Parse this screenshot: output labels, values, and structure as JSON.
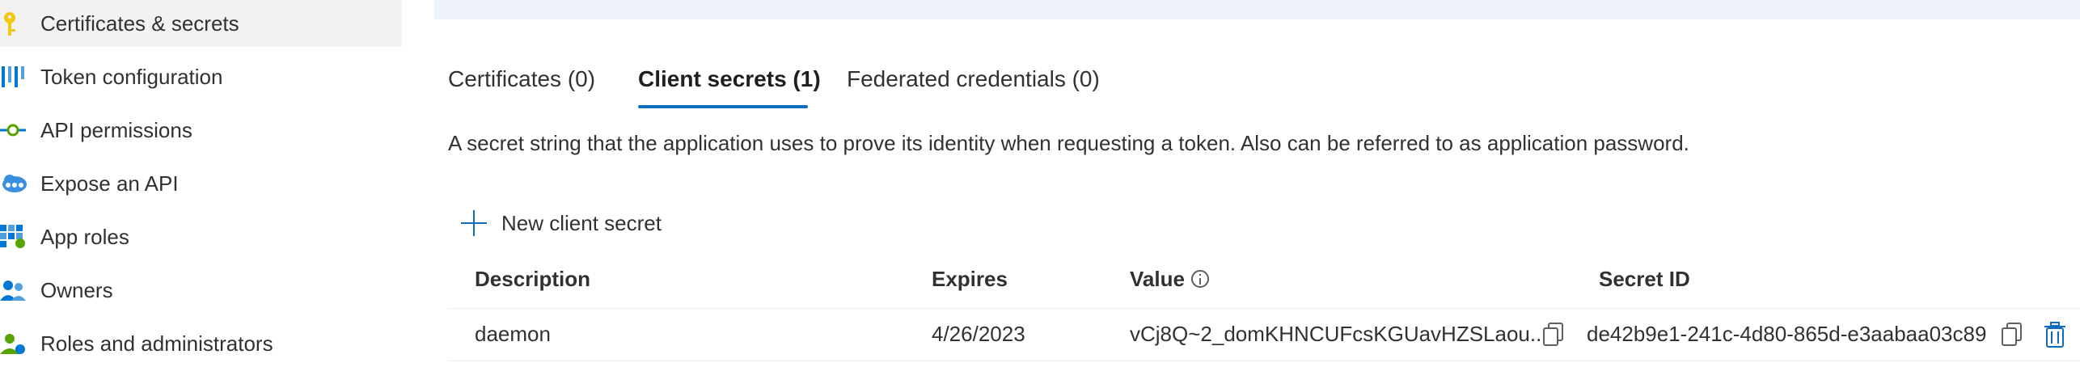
{
  "sidebar": {
    "items": [
      {
        "label": "Certificates & secrets",
        "icon": "key-icon",
        "selected": true
      },
      {
        "label": "Token configuration",
        "icon": "token-bars-icon",
        "selected": false
      },
      {
        "label": "API permissions",
        "icon": "api-permissions-icon",
        "selected": false
      },
      {
        "label": "Expose an API",
        "icon": "cloud-api-icon",
        "selected": false
      },
      {
        "label": "App roles",
        "icon": "app-roles-grid-icon",
        "selected": false
      },
      {
        "label": "Owners",
        "icon": "owners-people-icon",
        "selected": false
      },
      {
        "label": "Roles and administrators",
        "icon": "roles-admin-icon",
        "selected": false
      }
    ]
  },
  "tabs": [
    {
      "label": "Certificates (0)",
      "active": false
    },
    {
      "label": "Client secrets (1)",
      "active": true
    },
    {
      "label": "Federated credentials (0)",
      "active": false
    }
  ],
  "description": "A secret string that the application uses to prove its identity when requesting a token. Also can be referred to as application password.",
  "new_secret_label": "New client secret",
  "table": {
    "headers": {
      "description": "Description",
      "expires": "Expires",
      "value": "Value",
      "secret_id": "Secret ID"
    },
    "rows": [
      {
        "description": "daemon",
        "expires": "4/26/2023",
        "value": "vCj8Q~2_domKHNCUFcsKGUavHZSLaou...",
        "secret_id": "de42b9e1-241c-4d80-865d-e3aabaa03c89"
      }
    ]
  },
  "colors": {
    "accent": "#0f6cbd",
    "selected_bg": "#f3f2f1",
    "banner_bg": "#eef3fa",
    "text": "#323130"
  }
}
